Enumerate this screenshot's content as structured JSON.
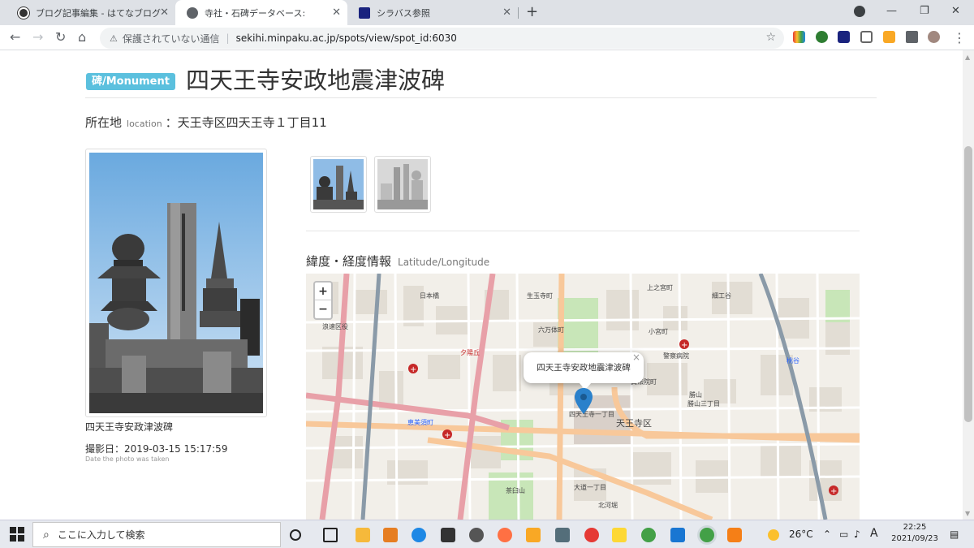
{
  "browser": {
    "tabs": [
      {
        "label": "ブログ記事編集 - はてなブログ",
        "close": "✕"
      },
      {
        "label": "寺社・石碑データベース:",
        "close": "✕"
      },
      {
        "label": "シラバス参照",
        "close": "✕"
      }
    ],
    "new_tab": "+",
    "security_warning": "保護されていない通信",
    "url": "sekihi.minpaku.ac.jp/spots/view/spot_id:6030",
    "window_controls": {
      "minimize": "—",
      "maximize": "❐",
      "close": "✕"
    }
  },
  "page": {
    "badge": "碑/Monument",
    "title": "四天王寺安政地震津波碑",
    "location_label": "所在地",
    "location_sub": "location",
    "location_value": "：天王寺区四天王寺１丁目11",
    "photo_caption": "四天王寺安政津波碑",
    "photo_date": "撮影日：2019-03-15 15:17:59",
    "photo_date_sub": "Date the photo was taken",
    "latlng_heading": "緯度・経度情報",
    "latlng_sub": "Latitude/Longitude"
  },
  "map": {
    "zoom_in": "+",
    "zoom_out": "−",
    "popup_text": "四天王寺安政地震津波碑",
    "popup_close": "×",
    "labels": {
      "seisuji": "生玉寺町",
      "rokuman": "六万体町",
      "kozai": "小宮町",
      "keisatsu": "警察病院",
      "shinpo": "真法院町",
      "katsuyama": "勝山",
      "tennojiku": "天王寺区",
      "shitennoji1": "四天王寺一丁目",
      "ebisu": "恵美須町",
      "yuhigaoka": "夕陽丘",
      "nihonbashi": "日本橋",
      "namba": "浪速区役",
      "kitakawa": "北河堀",
      "otsu": "大道一丁目",
      "chausuyama": "茶臼山",
      "momodani": "桃谷",
      "kamino": "上之宮町",
      "ueno": "細工谷",
      "ikutama": "生玉寺町",
      "kaisen": "勝山三丁目"
    }
  },
  "taskbar": {
    "search_placeholder": "ここに入力して検索",
    "weather": "26°C",
    "ime": "A",
    "time": "22:25",
    "date": "2021/09/23"
  }
}
